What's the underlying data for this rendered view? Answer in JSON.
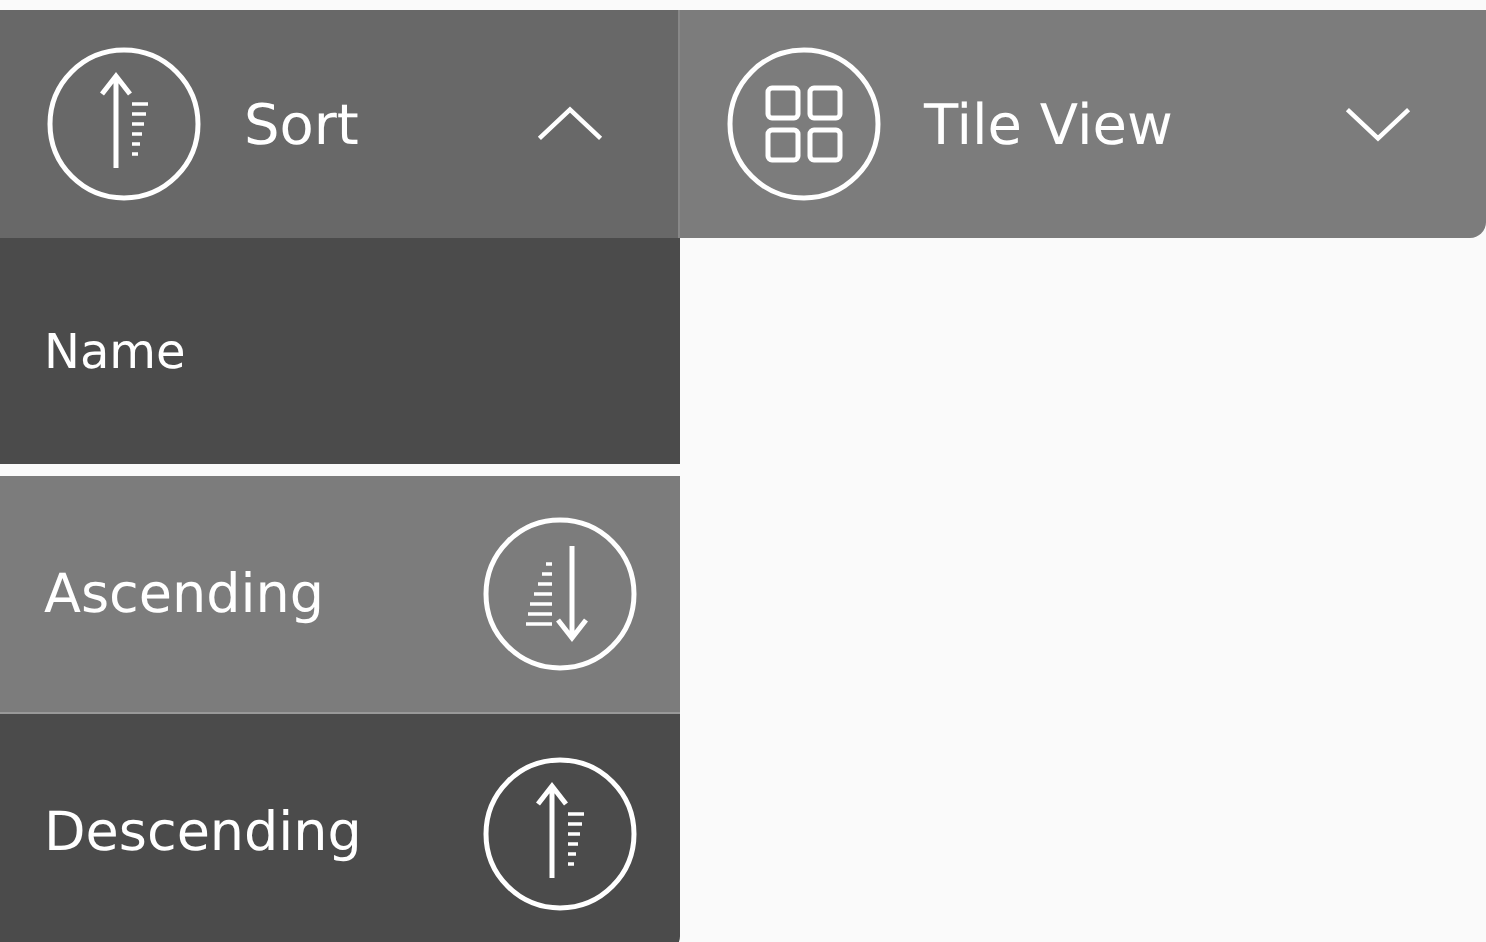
{
  "toolbar": {
    "sort_button": {
      "label": "Sort",
      "expanded": true
    },
    "view_button": {
      "label": "Tile View",
      "expanded": false
    }
  },
  "sort_menu": {
    "field": "Name",
    "orders": [
      {
        "label": "Ascending",
        "kind": "ascending",
        "selected": true
      },
      {
        "label": "Descending",
        "kind": "descending",
        "selected": false
      }
    ]
  }
}
